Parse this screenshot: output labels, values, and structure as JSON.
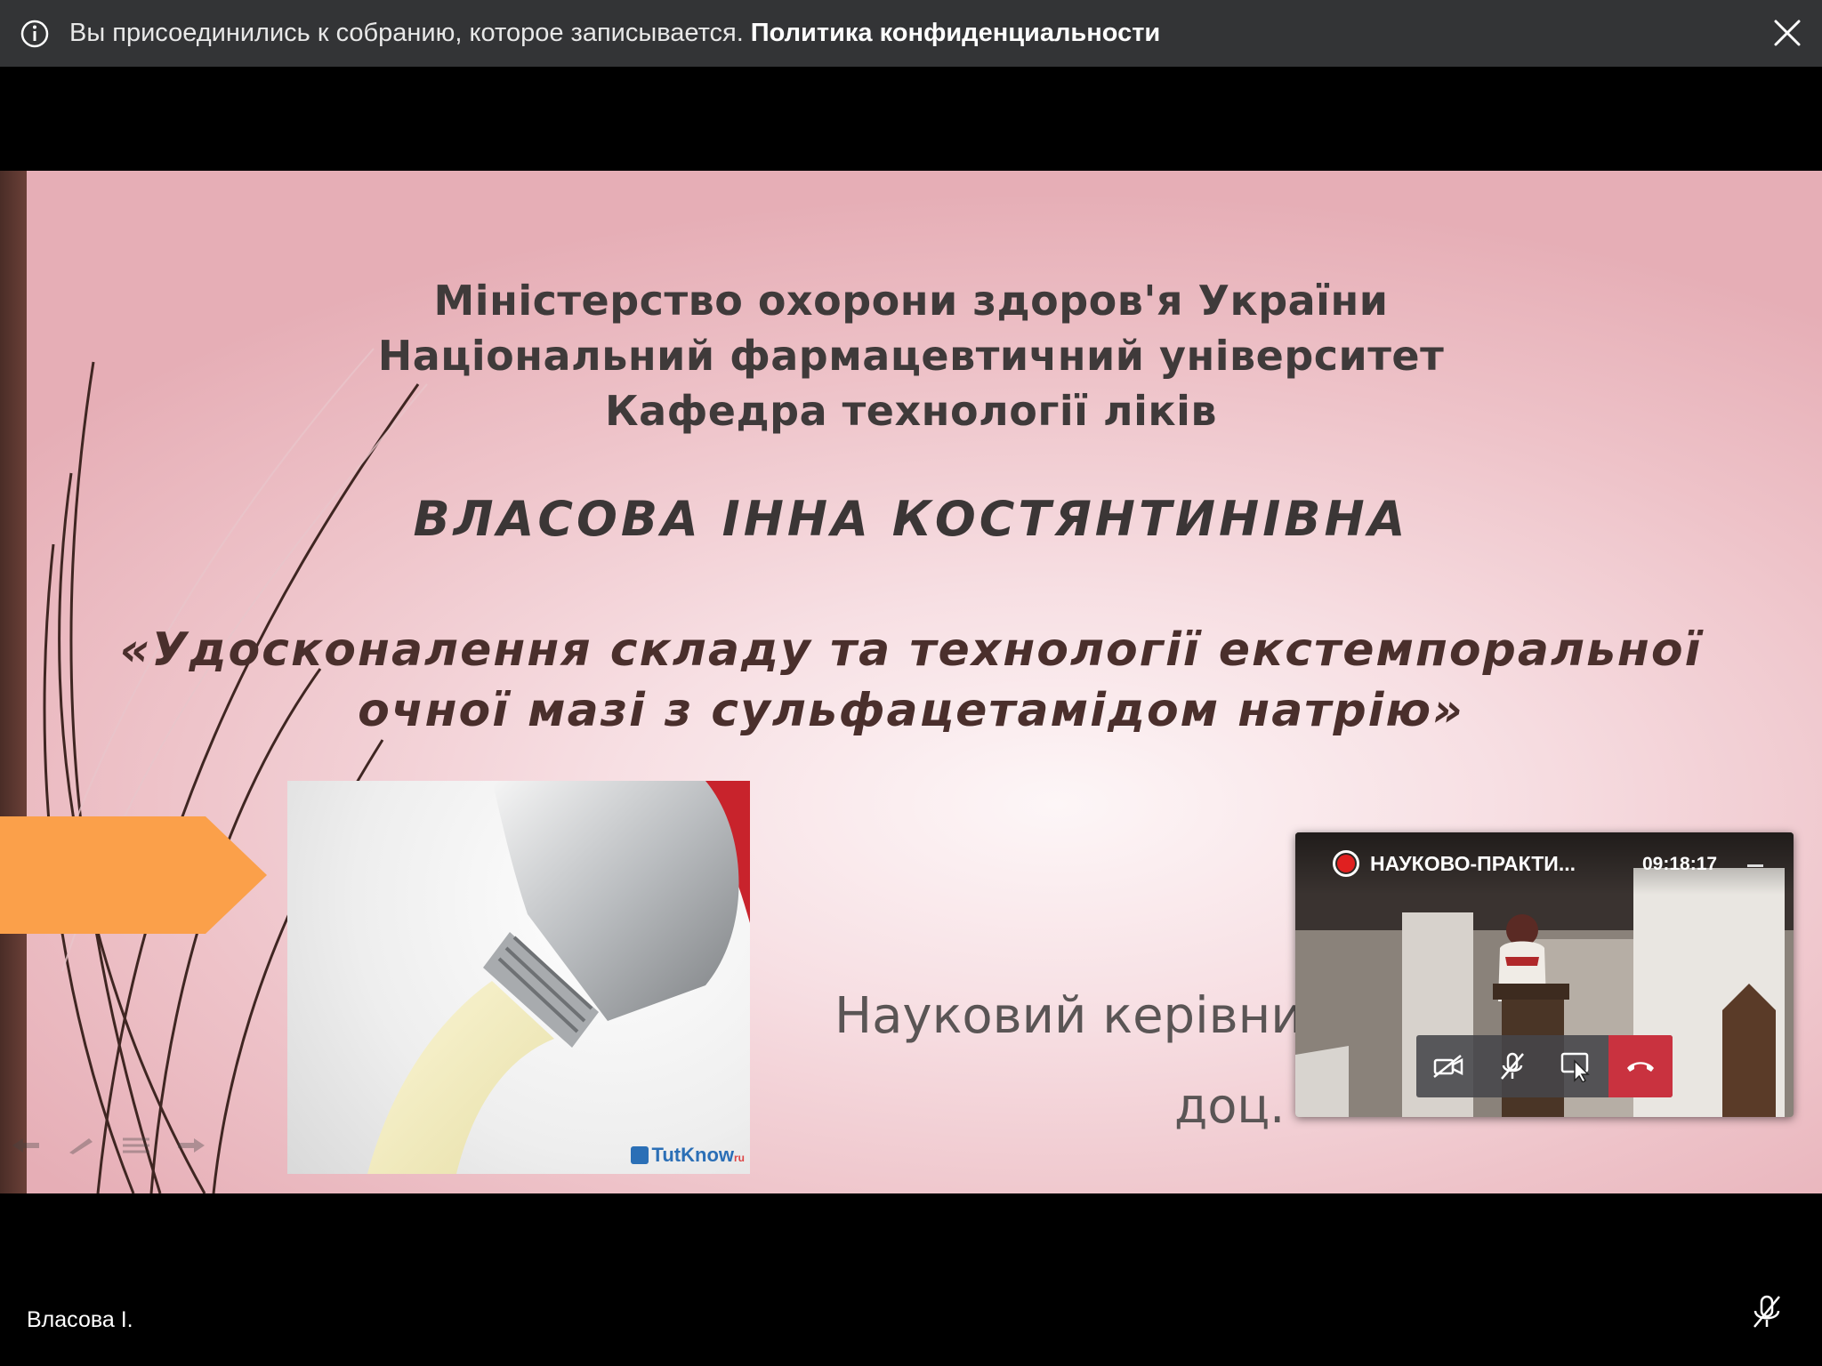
{
  "banner": {
    "message": "Вы присоединились к собранию, которое записывается.",
    "policy_link": "Политика конфиденциальности",
    "info_icon": "info-icon",
    "close_icon": "close-icon"
  },
  "slide": {
    "org_lines": [
      "Міністерство охорони здоров'я України",
      "Національний фармацевтичний університет",
      "Кафедра технології ліків"
    ],
    "author": "ВЛАСОВА ІННА КОСТЯНТИНІВНА",
    "thesis_lines": [
      "«Удосконалення складу та технології екстемпоральної",
      "очної мазі з сульфацетамідом натрію»"
    ],
    "supervisor_label": "Науковий керівни",
    "supervisor_line2": "доц.",
    "image_watermark": "TutKnow",
    "image_watermark_suffix": "ru",
    "colors": {
      "arrow": "#fba04a",
      "left_bar": "#4a2d27"
    }
  },
  "mini_call": {
    "title": "НАУКОВО-ПРАКТИ...",
    "time": "09:18:17",
    "controls": [
      "camera-off-icon",
      "mic-off-icon",
      "share-screen-icon",
      "hang-up-icon"
    ],
    "colors": {
      "hangup": "#c9323f",
      "record": "#e02020"
    }
  },
  "participant": {
    "name": "Власова І.",
    "mic_icon": "mic-muted-icon"
  }
}
